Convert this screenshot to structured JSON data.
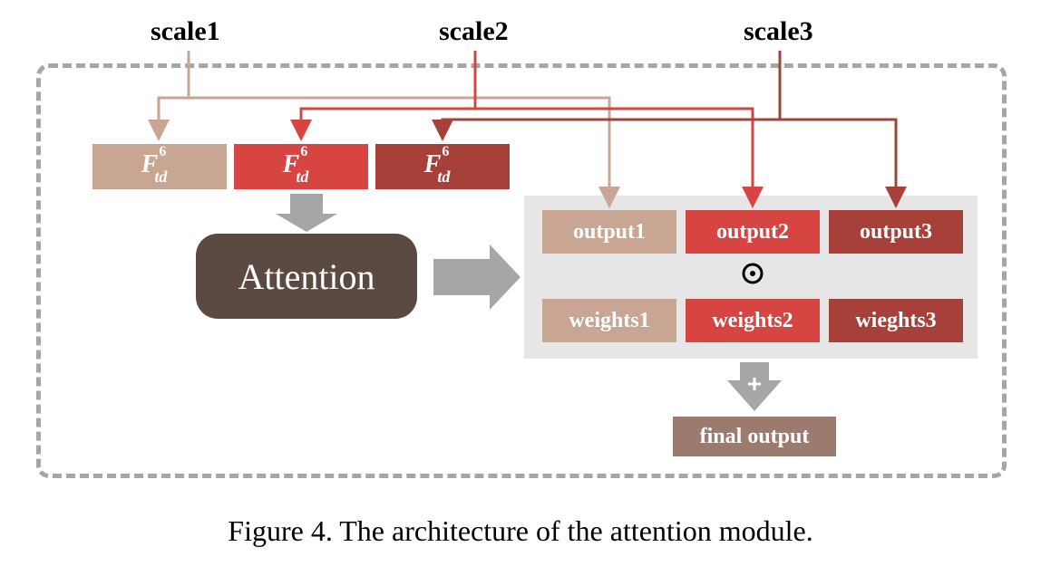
{
  "labels": {
    "scale1": "scale1",
    "scale2": "scale2",
    "scale3": "scale3"
  },
  "ftd": {
    "base": "F",
    "sup": "6",
    "sub": "td"
  },
  "attention": "Attention",
  "outputs": {
    "o1": "output1",
    "o2": "output2",
    "o3": "output3",
    "w1": "weights1",
    "w2": "weights2",
    "w3": "wieghts3"
  },
  "final": "final output",
  "caption": "Figure 4. The architecture of the attention module.",
  "colors": {
    "tan": "#c8a693",
    "red": "#d64541",
    "darkred": "#a8403a",
    "attnbg": "#5b4a42",
    "finalbg": "#9c7b6e",
    "grey": "#e7e6e6",
    "dash": "#a6a6a6",
    "arrowgrey": "#a6a6a6"
  }
}
